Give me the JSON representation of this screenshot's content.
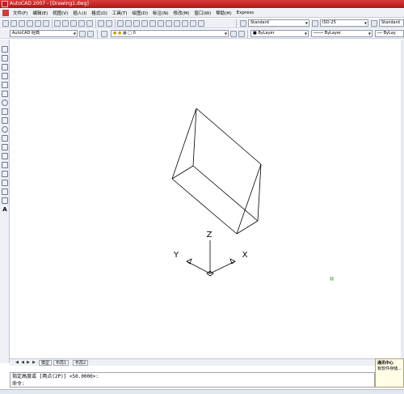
{
  "window": {
    "title": "AutoCAD 2007 - [Drawing1.dwg]"
  },
  "menubar": {
    "items": [
      "文件(F)",
      "编辑(E)",
      "视图(V)",
      "插入(I)",
      "格式(O)",
      "工具(T)",
      "绘图(D)",
      "标注(N)",
      "修改(M)",
      "窗口(W)",
      "帮助(H)",
      "Express"
    ]
  },
  "toolbar": {
    "text_style": "Standard",
    "dim_style": "ISO-25",
    "table_style": "Standard"
  },
  "properties": {
    "workspace": "AutoCAD 经典",
    "layer": "0",
    "color": "ByLayer",
    "linetype": "ByLayer",
    "lineweight": "ByLay"
  },
  "ucs": {
    "x_label": "X",
    "y_label": "Y",
    "z_label": "Z"
  },
  "layout_tabs": {
    "tabs": [
      "模型",
      "布局1",
      "布局2"
    ]
  },
  "command": {
    "history": "指定高度或 [两点(2P)] <50.0000>:",
    "prompt": "命令:"
  },
  "balloon": {
    "title": "通讯中心",
    "text": "有软件存储..."
  },
  "colors": {
    "title_bar": "#c42727",
    "canvas": "#ffffff",
    "ui_background": "#eef0f5"
  }
}
